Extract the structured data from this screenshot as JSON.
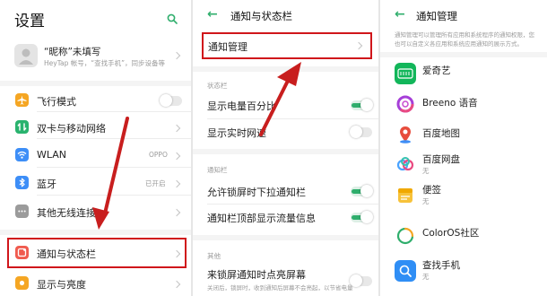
{
  "settings": {
    "title": "设置",
    "profile": {
      "name": "“昵称”未填写",
      "sub": "HeyTap 帐号，“查找手机”，同步设备等"
    },
    "items": [
      {
        "label": "飞行模式",
        "value": ""
      },
      {
        "label": "双卡与移动网络",
        "value": ""
      },
      {
        "label": "WLAN",
        "value": "OPPO"
      },
      {
        "label": "蓝牙",
        "value": "已开启"
      },
      {
        "label": "其他无线连接",
        "value": ""
      },
      {
        "label": "通知与状态栏",
        "value": ""
      },
      {
        "label": "显示与亮度",
        "value": ""
      }
    ]
  },
  "status_bar_page": {
    "title": "通知与状态栏",
    "notification_mgmt": "通知管理",
    "section_status": "状态栏",
    "battery_percent": "显示电量百分比",
    "realtime_speed": "显示实时网速",
    "section_notification": "通知栏",
    "lockscreen_pulldown": "允许锁屏时下拉通知栏",
    "top_traffic": "通知栏顶部显示流量信息",
    "section_other": "其他",
    "lockscreen_wake": "来锁屏通知时点亮屏幕",
    "lockscreen_wake_sub": "关闭后，锁屏时，收到通知后屏幕不会亮起，以节省电量"
  },
  "notification_mgmt_page": {
    "title": "通知管理",
    "description": "通知管理可以管理所有应用和系统程序的通知权限，您也可以自定义各应用和系统应用通知的展示方式。",
    "apps": [
      {
        "name": "爱奇艺",
        "sub": ""
      },
      {
        "name": "Breeno 语音",
        "sub": ""
      },
      {
        "name": "百度地图",
        "sub": ""
      },
      {
        "name": "百度网盘",
        "sub": "无"
      },
      {
        "name": "便签",
        "sub": "无"
      },
      {
        "name": "ColorOS社区",
        "sub": ""
      },
      {
        "name": "查找手机",
        "sub": "无"
      }
    ]
  },
  "colors": {
    "accent": "#2fae6c",
    "highlight": "#d0161b"
  }
}
